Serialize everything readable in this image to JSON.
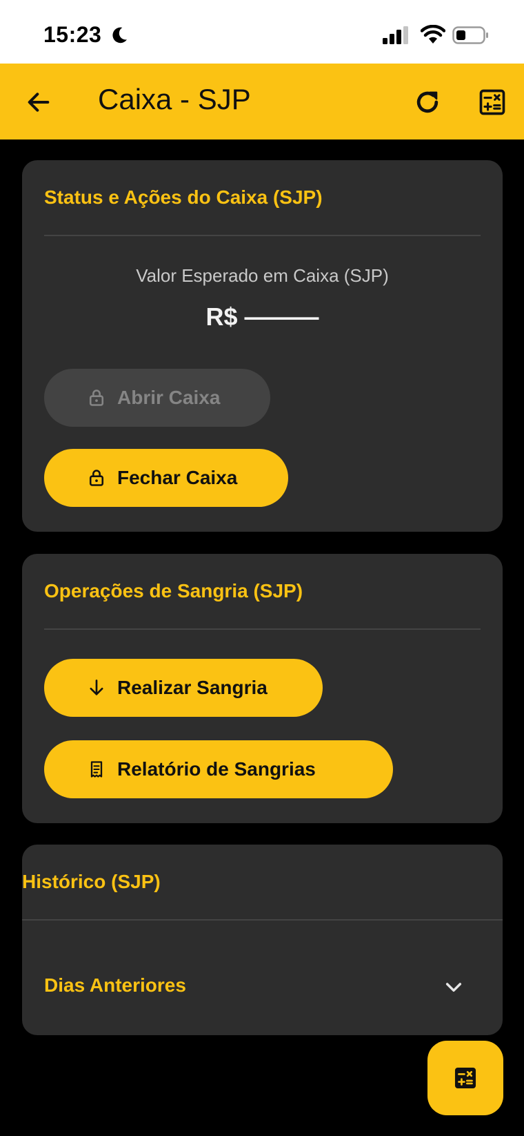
{
  "status_bar": {
    "time": "15:23",
    "icons": [
      "moon-icon",
      "cellular-signal-icon",
      "wifi-icon",
      "battery-icon"
    ]
  },
  "app_bar": {
    "title": "Caixa - SJP",
    "icons": [
      "back-arrow-icon",
      "refresh-icon",
      "calculator-icon"
    ]
  },
  "status_card": {
    "title": "Status e Ações do Caixa (SJP)",
    "expected_label": "Valor Esperado em Caixa (SJP)",
    "expected_value": "R$ ———",
    "open_button": "Abrir Caixa",
    "close_button": "Fechar Caixa"
  },
  "sangria_card": {
    "title": "Operações de Sangria (SJP)",
    "sangria_button": "Realizar Sangria",
    "report_button": "Relatório de Sangrias"
  },
  "history_card": {
    "title": "Histórico (SJP)",
    "expander_label": "Dias Anteriores"
  },
  "colors": {
    "accent": "#FBC213",
    "background": "#000000",
    "card": "#2D2D2D",
    "disabled_button": "#434343"
  }
}
